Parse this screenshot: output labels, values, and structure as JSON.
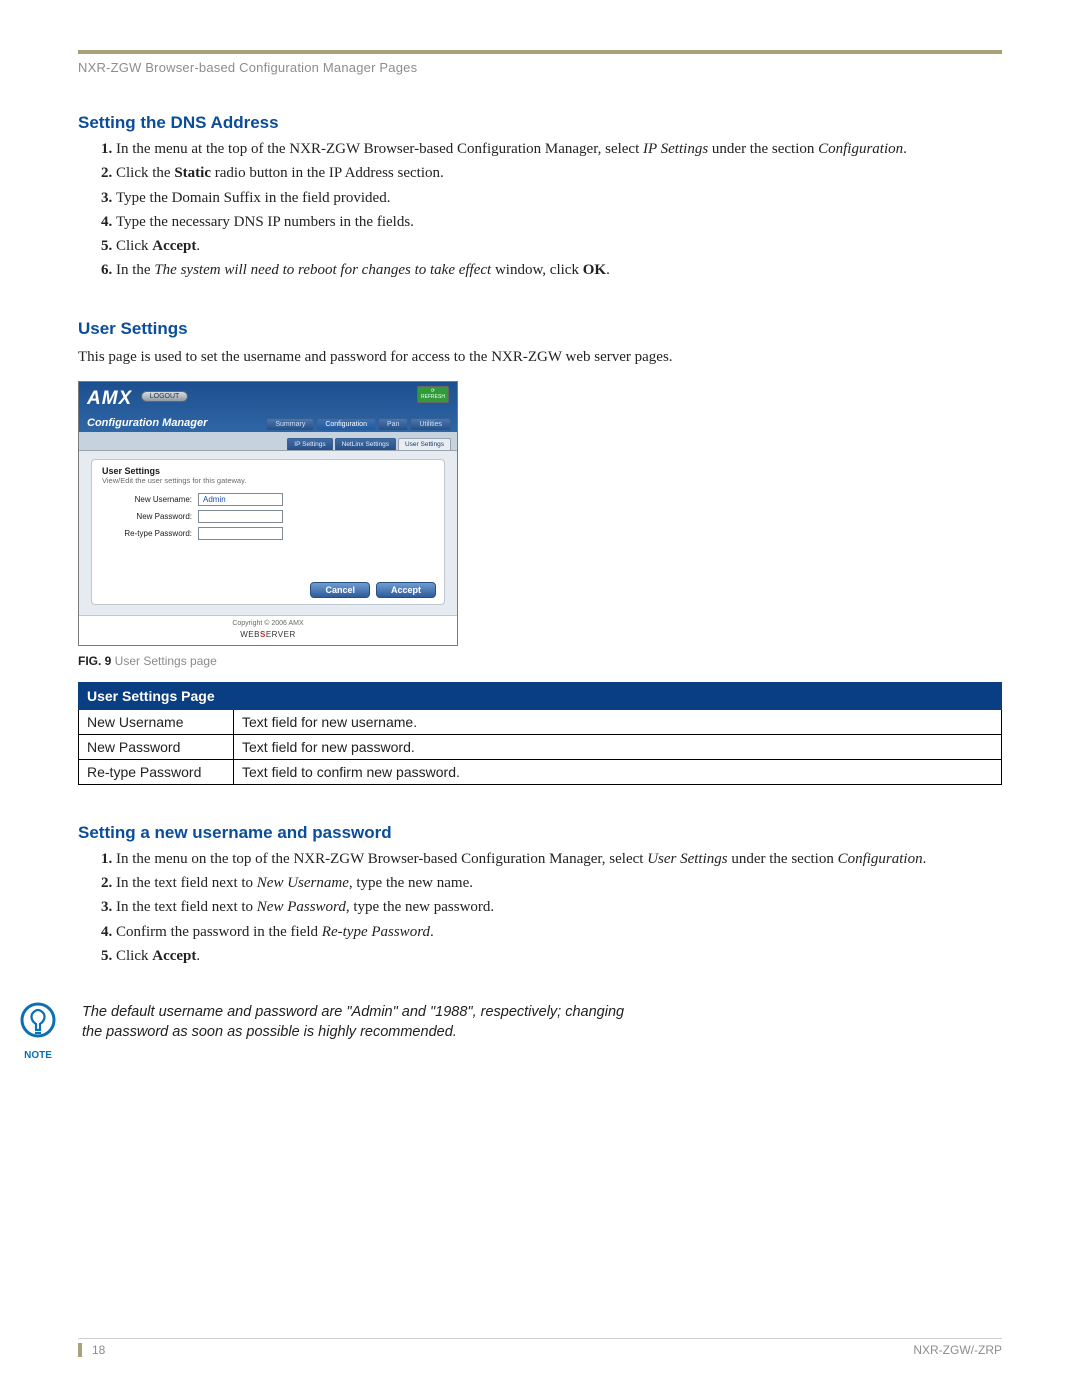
{
  "running_head": "NXR-ZGW Browser-based Configuration Manager Pages",
  "sections": {
    "dns": {
      "title": "Setting the DNS Address",
      "steps": [
        {
          "pre": "In the menu at the top of the NXR-ZGW Browser-based Configuration Manager, select ",
          "ital": "IP Settings",
          "post": " under the section ",
          "ital2": "Configuration",
          "post2": "."
        },
        {
          "pre": "Click the ",
          "bold": "Static",
          "post": " radio button in the IP Address section."
        },
        {
          "plain": "Type the Domain Suffix in the field provided."
        },
        {
          "plain": "Type the necessary DNS IP numbers in the fields."
        },
        {
          "pre": "Click ",
          "bold": "Accept",
          "post": "."
        },
        {
          "pre": "In the ",
          "ital": "The system will need to reboot for changes to take effect",
          "post": " window, click ",
          "bold": "OK",
          "post2": "."
        }
      ]
    },
    "user_settings": {
      "title": "User Settings",
      "intro": "This page is used to set the username and password for access to the NXR-ZGW web server pages."
    },
    "new_unpw": {
      "title": "Setting a new username and password",
      "steps": [
        {
          "pre": "In the menu on the top of the NXR-ZGW Browser-based Configuration Manager, select ",
          "ital": "User Settings",
          "post": " under the section ",
          "ital2": "Configuration",
          "post2": "."
        },
        {
          "pre": "In the text field next to ",
          "ital": "New Username",
          "post": ", type the new name."
        },
        {
          "pre": "In the text field next to ",
          "ital": "New Password",
          "post": ", type the new password."
        },
        {
          "pre": "Confirm the password in the field ",
          "ital": "Re-type Password",
          "post": "."
        },
        {
          "pre": "Click ",
          "bold": "Accept",
          "post": "."
        }
      ]
    }
  },
  "screenshot": {
    "logo": "AMX",
    "logout": "LOGOUT",
    "refresh": "REFRESH",
    "cm_title": "Configuration Manager",
    "main_tabs": [
      "Summary",
      "Configuration",
      "Pan",
      "Utilities"
    ],
    "active_main_tab": 1,
    "sub_tabs": [
      "IP Settings",
      "NetLinx Settings",
      "User Settings"
    ],
    "active_sub_tab": 2,
    "panel_title": "User Settings",
    "panel_sub": "View/Edit the user settings for this gateway.",
    "fields": {
      "new_username_label": "New Username:",
      "new_username_value": "Admin",
      "new_password_label": "New Password:",
      "retype_password_label": "Re-type Password:"
    },
    "buttons": {
      "cancel": "Cancel",
      "accept": "Accept"
    },
    "copyright": "Copyright © 2006 AMX",
    "wb_prefix": "WEB",
    "wb_s": "S",
    "wb_suffix": "ERVER"
  },
  "fig_caption": {
    "strong": "FIG. 9",
    "rest": "  User Settings page"
  },
  "table": {
    "header": "User Settings Page",
    "rows": [
      {
        "k": "New Username",
        "v": "Text field for new username."
      },
      {
        "k": "New Password",
        "v": "Text field for new password."
      },
      {
        "k": "Re-type Password",
        "v": "Text field to confirm new password."
      }
    ]
  },
  "note": {
    "label": "NOTE",
    "text": "The default username and password are \"Admin\" and \"1988\", respectively; changing the password as soon as possible is highly recommended."
  },
  "footer": {
    "page": "18",
    "doc": "NXR-ZGW/-ZRP"
  }
}
